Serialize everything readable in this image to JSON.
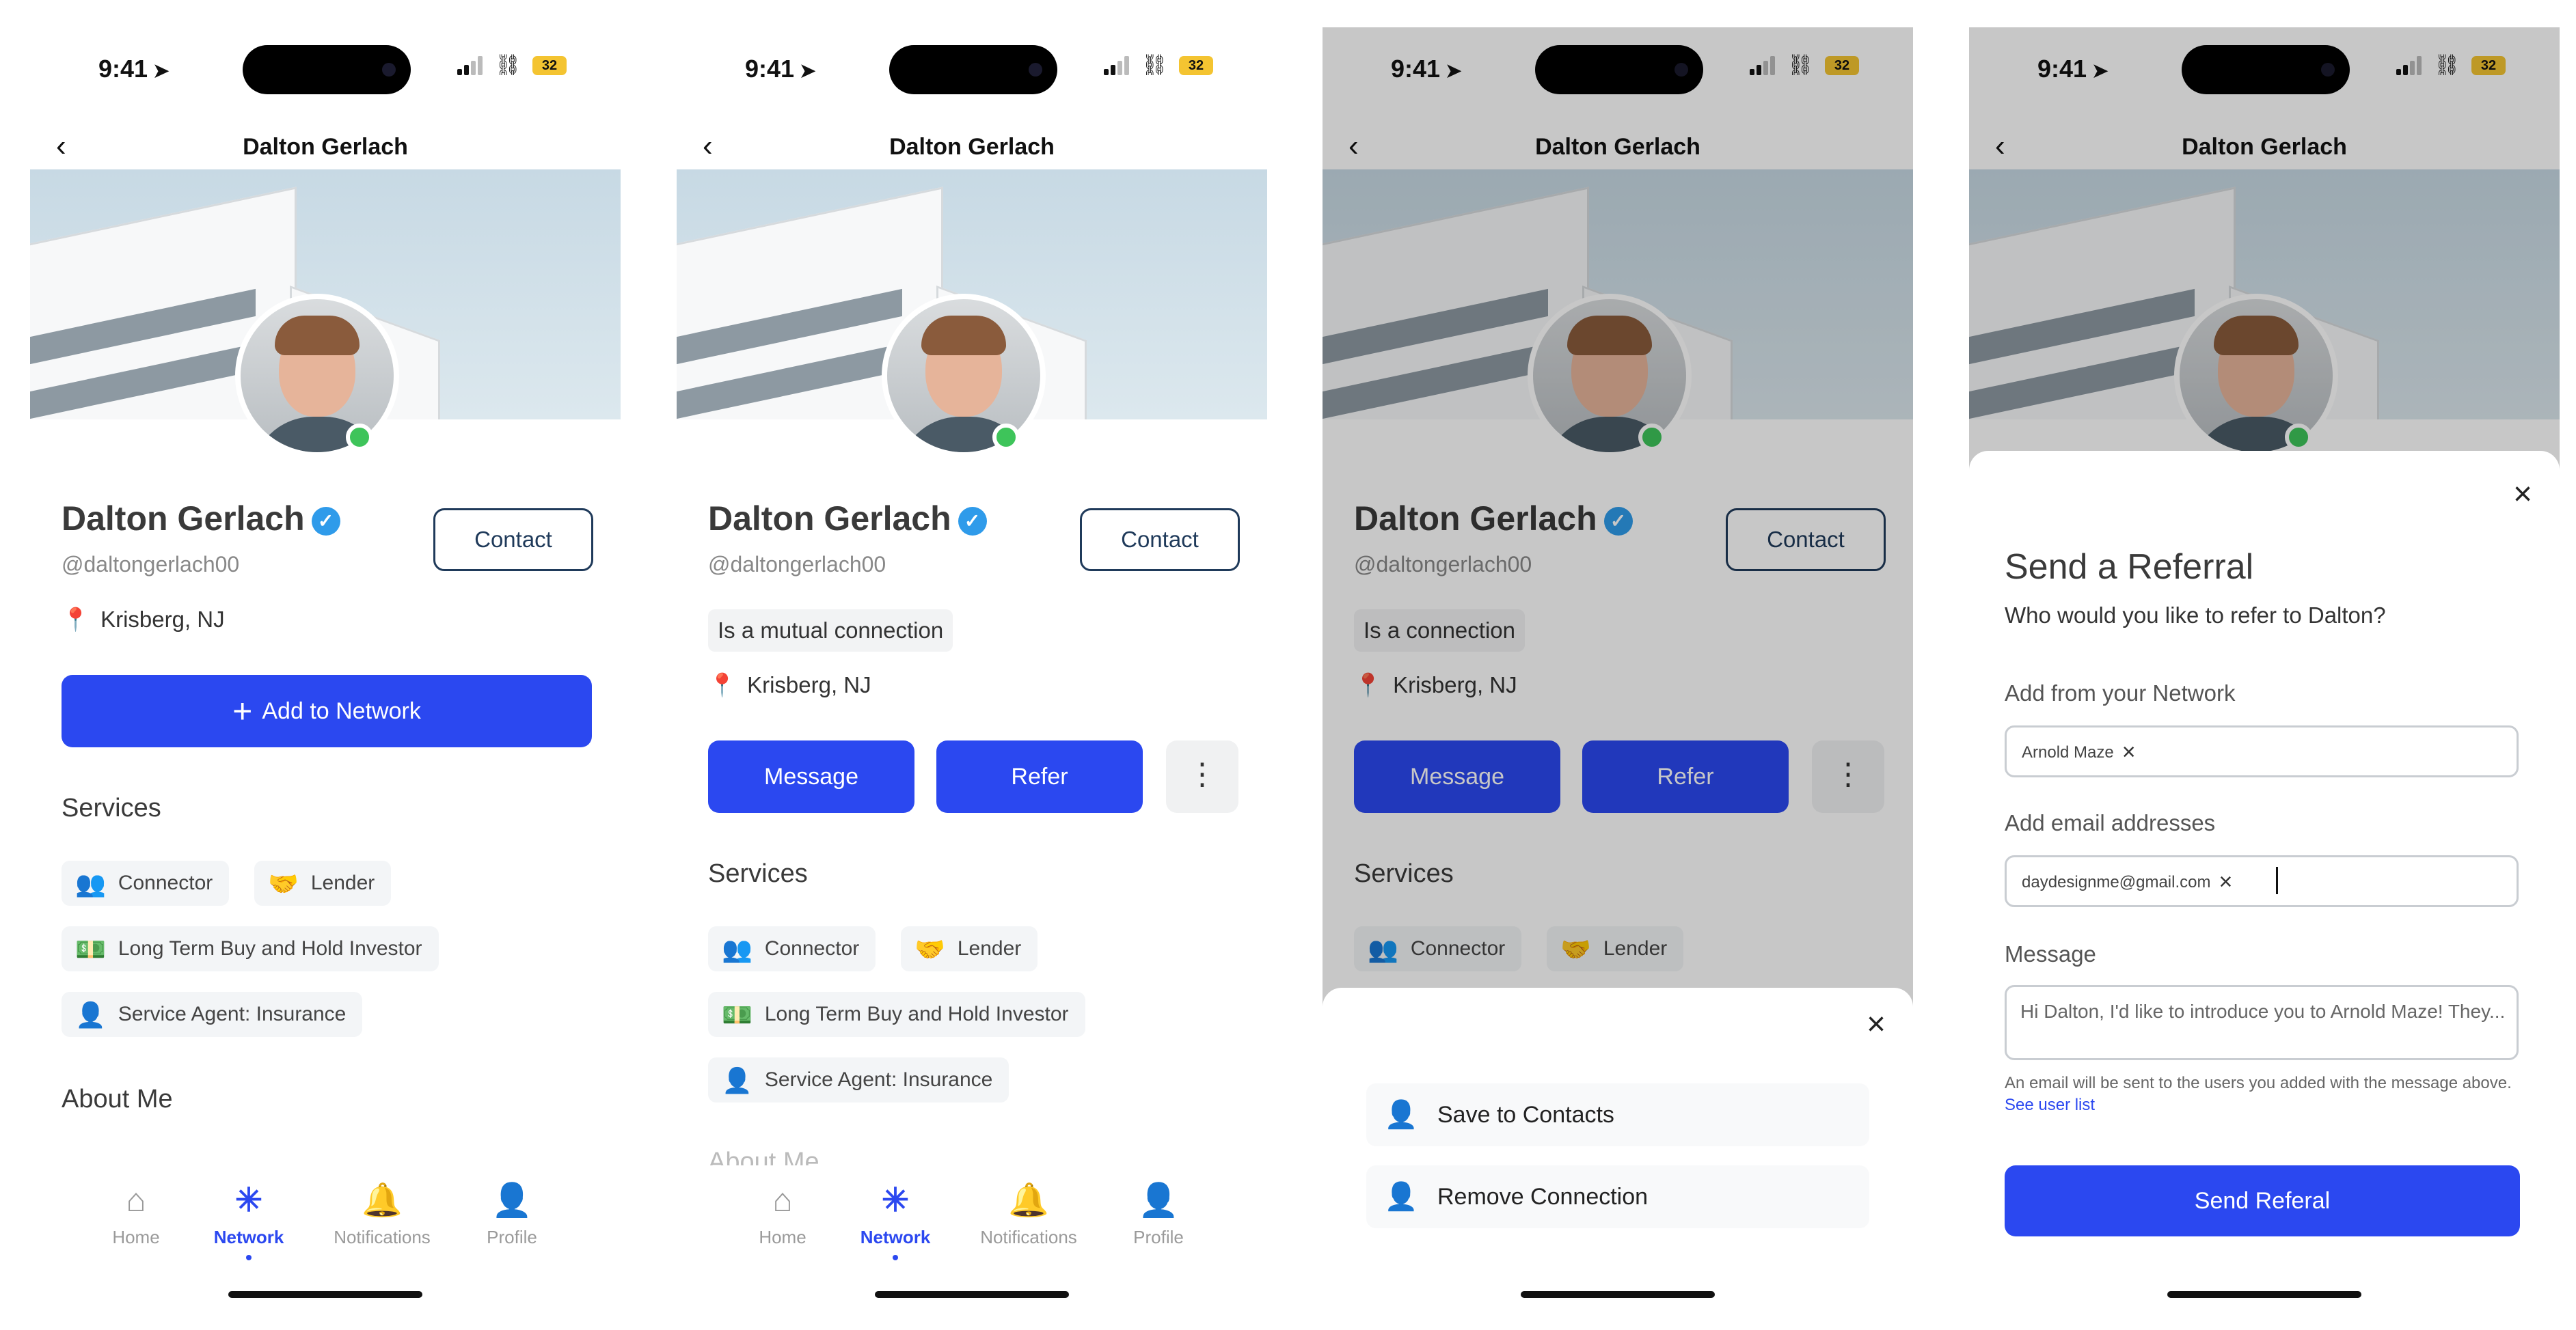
{
  "status": {
    "time": "9:41",
    "battery": "32"
  },
  "header": {
    "title": "Dalton Gerlach"
  },
  "profile": {
    "name": "Dalton Gerlach",
    "handle": "@daltongerlach00",
    "location": "Krisberg, NJ",
    "contact_label": "Contact",
    "mutual_label": "Is a mutual connection",
    "connection_label": "Is a connection"
  },
  "actions": {
    "add_to_network": "Add to Network",
    "message": "Message",
    "refer": "Refer"
  },
  "services": {
    "title": "Services",
    "items": [
      {
        "label": "Connector",
        "icon": "users-icon"
      },
      {
        "label": "Lender",
        "icon": "handshake-icon"
      },
      {
        "label": "Long Term Buy and Hold Investor",
        "icon": "money-icon"
      },
      {
        "label": "Service Agent: Insurance",
        "icon": "user-shield-icon"
      }
    ]
  },
  "about": {
    "title": "About Me"
  },
  "tabbar": {
    "items": [
      {
        "label": "Home",
        "icon": "home-icon"
      },
      {
        "label": "Network",
        "icon": "network-icon"
      },
      {
        "label": "Notifications",
        "icon": "bell-icon"
      },
      {
        "label": "Profile",
        "icon": "profile-icon"
      }
    ],
    "active": "Network"
  },
  "menu_sheet": {
    "items": [
      {
        "label": "Save to Contacts",
        "icon": "user-check-icon"
      },
      {
        "label": "Remove Connection",
        "icon": "user-remove-icon"
      }
    ]
  },
  "referral": {
    "title": "Send a Referral",
    "subtitle": "Who would you like to refer to Dalton?",
    "network_label": "Add from your Network",
    "network_tag": "Arnold Maze",
    "email_label": "Add email addresses",
    "email_tag": "daydesignme@gmail.com",
    "message_label": "Message",
    "message_value": "Hi Dalton, I'd like to introduce you to Arnold Maze! They...",
    "note": "An email will be sent to the users you added with the message above.",
    "note_link": "See user list",
    "send_label": "Send Referal"
  },
  "colors": {
    "primary": "#2b48f0",
    "online": "#3ec45a",
    "verified": "#2f9bea",
    "contact_border": "#1f3a5a"
  }
}
